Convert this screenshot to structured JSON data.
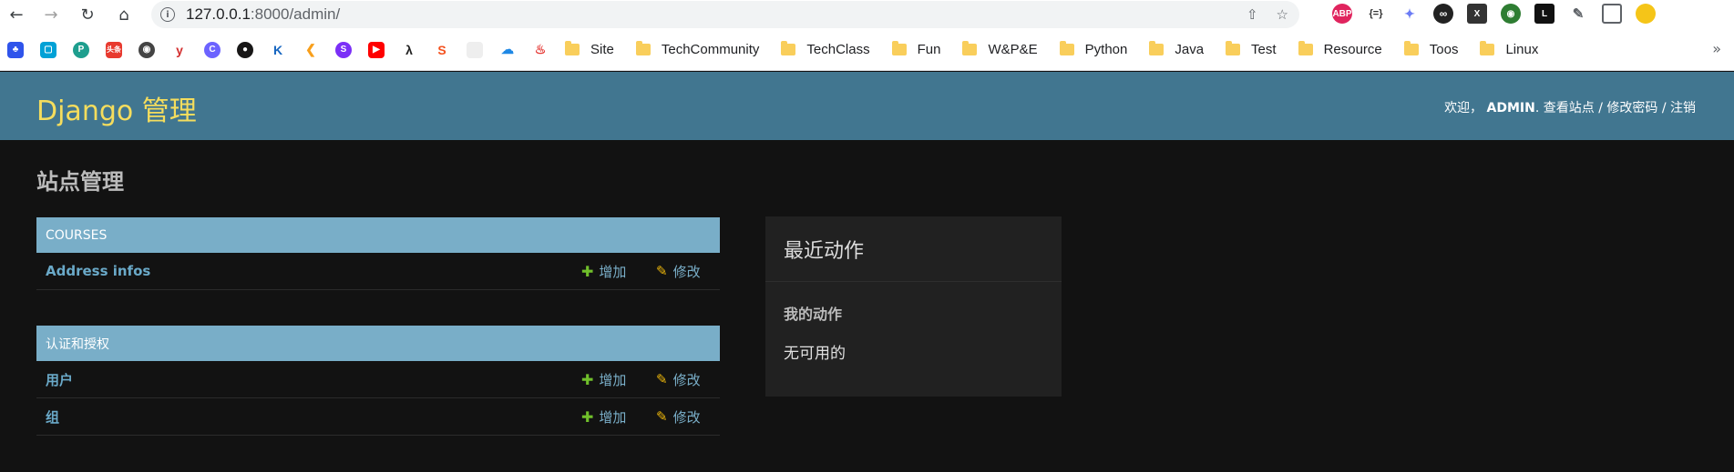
{
  "browser": {
    "url_host": "127.0.0.1",
    "url_rest": ":8000/admin/",
    "bookmarks": [
      "Site",
      "TechCommunity",
      "TechClass",
      "Fun",
      "W&P&E",
      "Python",
      "Java",
      "Test",
      "Resource",
      "Toos",
      "Linux"
    ],
    "ext_abp": "ABP",
    "ext_bm_news": "头条"
  },
  "header": {
    "brand": "Django 管理",
    "welcome": "欢迎，",
    "username": "ADMIN",
    "view_site": "查看站点",
    "change_password": "修改密码",
    "logout": "注销",
    "sep": " / ",
    "dot": ". "
  },
  "main": {
    "title": "站点管理",
    "modules": [
      {
        "caption": "COURSES",
        "rows": [
          {
            "name": "Address infos",
            "add": "增加",
            "change": "修改"
          }
        ]
      },
      {
        "caption": "认证和授权",
        "rows": [
          {
            "name": "用户",
            "add": "增加",
            "change": "修改"
          },
          {
            "name": "组",
            "add": "增加",
            "change": "修改"
          }
        ]
      }
    ]
  },
  "recent": {
    "title": "最近动作",
    "subtitle": "我的动作",
    "empty": "无可用的"
  }
}
